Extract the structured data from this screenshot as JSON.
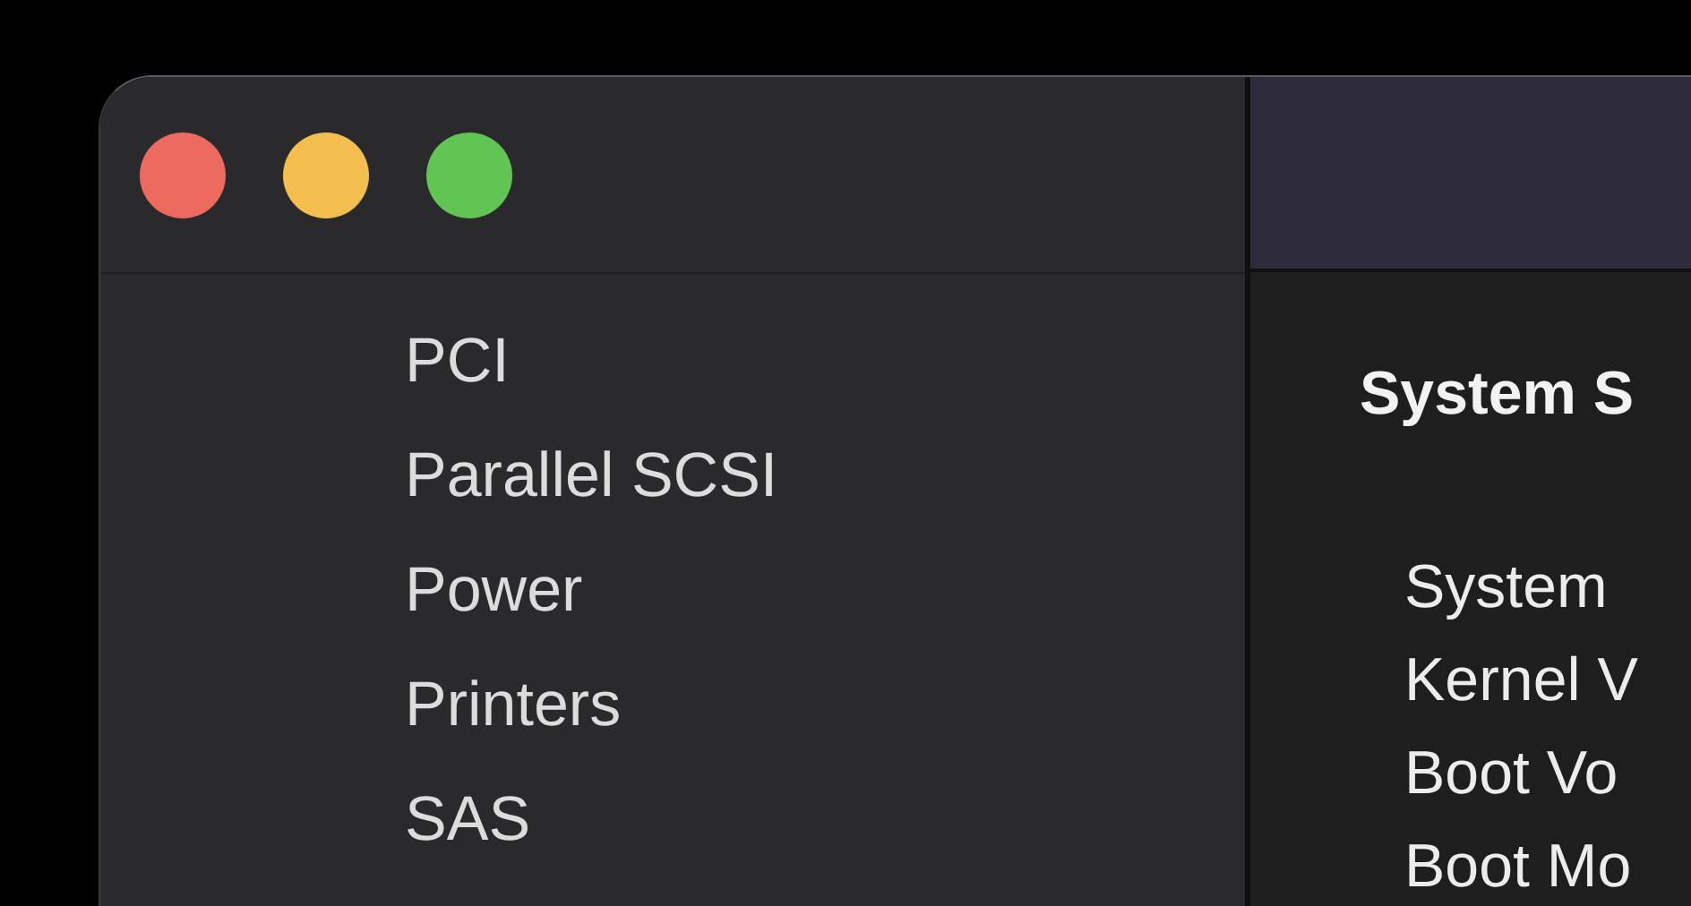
{
  "sidebar": {
    "items": [
      {
        "label": "PCI"
      },
      {
        "label": "Parallel SCSI"
      },
      {
        "label": "Power"
      },
      {
        "label": "Printers"
      },
      {
        "label": "SAS"
      }
    ]
  },
  "content": {
    "title": "System S",
    "rows": [
      {
        "label": "System"
      },
      {
        "label": "Kernel V"
      },
      {
        "label": "Boot Vo"
      },
      {
        "label": "Boot Mo"
      }
    ]
  }
}
